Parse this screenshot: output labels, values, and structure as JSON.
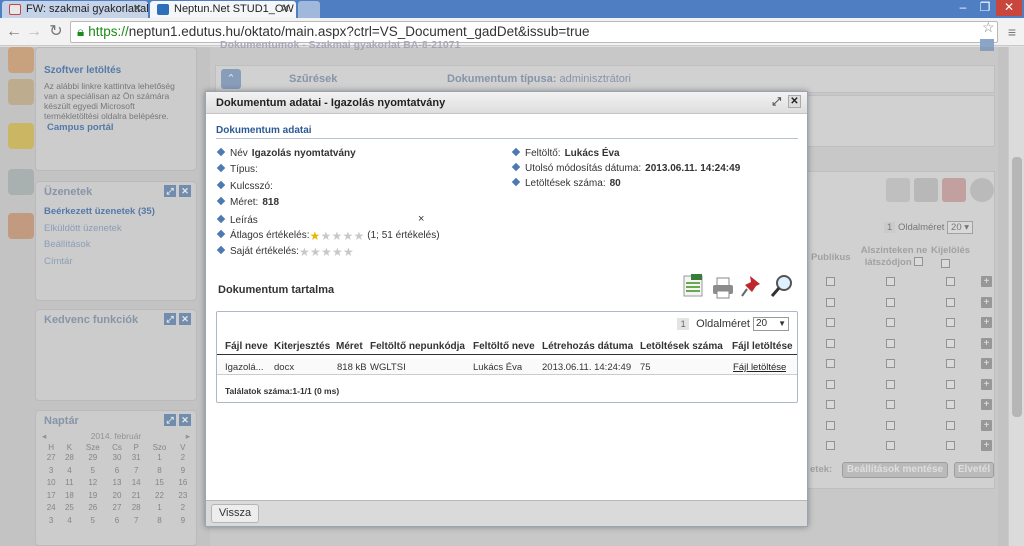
{
  "browser": {
    "tabs": [
      {
        "label": "FW: szakmai gyakorlattal k"
      },
      {
        "label": "Neptun.Net STUD1_OW"
      }
    ],
    "url_scheme": "https://",
    "url_rest": "neptun1.edutus.hu/oktato/main.aspx?ctrl=VS_Document_gadDet&issub=true"
  },
  "sidebar": {
    "software_title": "Szoftver letöltés",
    "software_text": "Az alábbi linkre kattintva lehetőség van a speciálisan az Ön számára készült egyedi Microsoft termékletöltési oldalra belépésre.",
    "campus_link": "Campus portál",
    "messages_title": "Üzenetek",
    "messages": [
      "Beérkezett üzenetek (35)",
      "Elküldött üzenetek",
      "Beállítások",
      "Címtár"
    ],
    "favorites_title": "Kedvenc funkciók",
    "calendar_title": "Naptár",
    "calendar_month": "2014. február",
    "calendar_days": [
      "H",
      "K",
      "Sze",
      "Cs",
      "P",
      "Szo",
      "V"
    ],
    "calendar_rows": [
      [
        "27",
        "28",
        "29",
        "30",
        "31",
        "1",
        "2"
      ],
      [
        "3",
        "4",
        "5",
        "6",
        "7",
        "8",
        "9"
      ],
      [
        "10",
        "11",
        "12",
        "13",
        "14",
        "15",
        "16"
      ],
      [
        "17",
        "18",
        "19",
        "20",
        "21",
        "22",
        "23"
      ],
      [
        "24",
        "25",
        "26",
        "27",
        "28",
        "1",
        "2"
      ],
      [
        "3",
        "4",
        "5",
        "6",
        "7",
        "8",
        "9"
      ]
    ]
  },
  "background": {
    "breadcrumb": "Dokumentumok - Szakmai gyakorlat BA-8-21071",
    "filters_label": "Szűrések",
    "doc_type_label": "Dokumentum típusa:",
    "doc_type_value": "adminisztrátori",
    "page_size_label": "Oldalméret",
    "page_size_value": "20",
    "page_num": "1",
    "col_publikus": "Publikus",
    "col_alszinteken": "Alszinteken ne látszódjon",
    "col_kijeloles": "Kijelölés",
    "save_settings": "Beállítások mentése",
    "discard": "Elvetél",
    "footer_label": "etek:"
  },
  "modal": {
    "title": "Dokumentum adatai - Igazolás nyomtatvány",
    "section_title": "Dokumentum adatai",
    "fields_left": [
      {
        "label": "Név",
        "value": "Igazolás nyomtatvány"
      },
      {
        "label": "Típus:",
        "value": ""
      },
      {
        "label": "Kulcsszó:",
        "value": ""
      },
      {
        "label": "Méret:",
        "value": "818"
      },
      {
        "label": "Leírás",
        "value": ""
      }
    ],
    "rating_avg_label": "Átlagos értékelés:",
    "rating_avg_text": "(1; 51 értékelés)",
    "rating_own_label": "Saját értékelés:",
    "rating_avg_stars": 1,
    "rating_own_stars": 0,
    "clear_rating": "×",
    "fields_right": [
      {
        "label": "Feltöltő:",
        "value": "Lukács Éva"
      },
      {
        "label": "Utolsó módosítás dátuma:",
        "value": "2013.06.11. 14:24:49"
      },
      {
        "label": "Letöltések száma:",
        "value": "80"
      }
    ],
    "content_title": "Dokumentum tartalma",
    "page_num": "1",
    "page_size_label": "Oldalméret",
    "page_size_value": "20",
    "columns": [
      "Fájl neve",
      "Kiterjesztés",
      "Méret",
      "Feltöltő nepunkódja",
      "Feltöltő neve",
      "Létrehozás dátuma",
      "Letöltések száma",
      "Fájl letöltése"
    ],
    "row": [
      "Igazolá...",
      "docx",
      "818 kB",
      "WGLTSI",
      "Lukács Éva",
      "2013.06.11. 14:24:49",
      "75",
      "Fájl letöltése"
    ],
    "results": "Találatok száma:1-1/1 (0 ms)",
    "back_button": "Vissza"
  },
  "colors": {
    "accent_blue": "#2a5a95",
    "star_gold": "#e6b800",
    "chrome_blue": "#4f7fc2"
  }
}
